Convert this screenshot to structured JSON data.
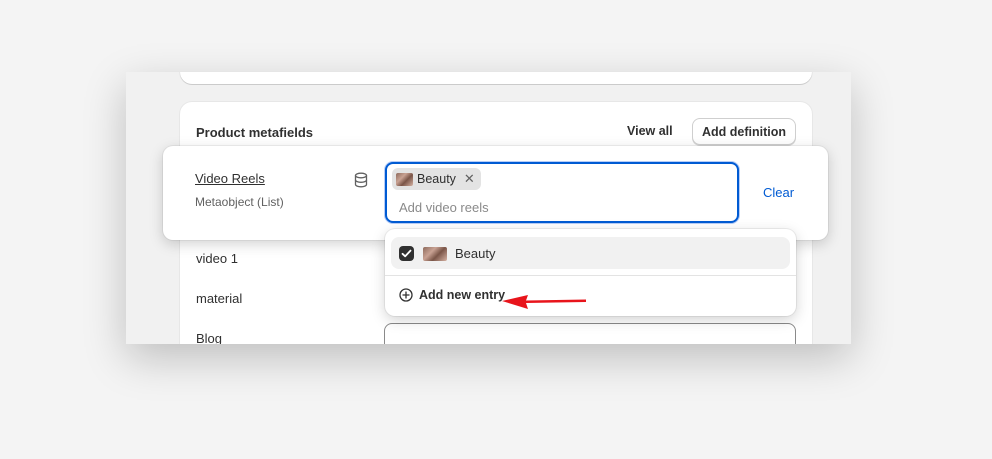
{
  "section": {
    "title": "Product metafields",
    "view_all_label": "View all",
    "add_definition_label": "Add definition"
  },
  "active_field": {
    "name": "Video Reels",
    "type": "Metaobject (List)",
    "icon": "database-icon",
    "selected_chip": "Beauty",
    "placeholder": "Add video reels",
    "clear_label": "Clear"
  },
  "dropdown": {
    "options": [
      {
        "label": "Beauty",
        "checked": true
      }
    ],
    "add_entry_label": "Add new entry"
  },
  "rows": [
    {
      "label": "video 1"
    },
    {
      "label": "material"
    },
    {
      "label": "Blog"
    }
  ],
  "colors": {
    "accent": "#005bd3",
    "annotation_arrow": "#e8141b",
    "surface": "#ffffff",
    "background": "#f1f1f1"
  }
}
